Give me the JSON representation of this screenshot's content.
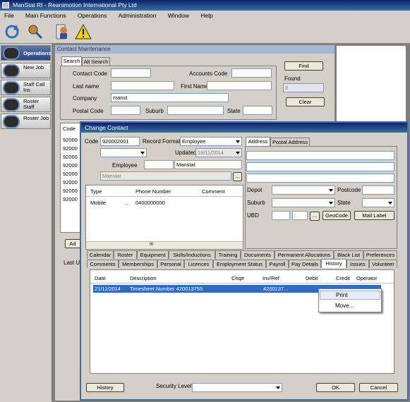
{
  "app": {
    "title": "ManStat RI - Reanimotion International Pty Ltd"
  },
  "menu": [
    "File",
    "Main Functions",
    "Operations",
    "Administration",
    "Window",
    "Help"
  ],
  "toolbar_icons": [
    "sync-icon",
    "search-people-icon",
    "user-card-icon",
    "warning-icon"
  ],
  "sidebar": {
    "items": [
      {
        "label": "Operations",
        "icon": "operations-icon"
      },
      {
        "label": "New Job",
        "icon": "new-job-icon"
      },
      {
        "label": "Staff Call Ins",
        "icon": "staff-call-icon"
      },
      {
        "label": "Roster Staff",
        "icon": "roster-staff-icon"
      },
      {
        "label": "Roster Job",
        "icon": "roster-job-icon"
      }
    ]
  },
  "contact_maintenance": {
    "title": "Contact Maintenance",
    "tabs": [
      "Search",
      "Alt Search"
    ],
    "fields": {
      "contact_code": "Contact Code",
      "accounts_code": "Accounts Code",
      "last_name": "Last name",
      "first_name": "First Name",
      "company": "Company",
      "company_value": "manst",
      "postal_code": "Postal Code",
      "suburb": "Suburb",
      "state": "State"
    },
    "find_button": "Find",
    "found_label": "Found",
    "found_value": "8",
    "clear_button": "Clear",
    "list_header": "Code",
    "list_codes": [
      "92000",
      "92000",
      "92000",
      "92000",
      "92000",
      "92000",
      "92000",
      "92000"
    ],
    "add_button_partial": "Ad",
    "last_upd_partial": "Last U"
  },
  "change_contact": {
    "title": "Change Contact",
    "code_label": "Code",
    "code_value": "920002001",
    "record_format_label": "Record Format",
    "record_format_value": "Employee",
    "updated_label": "Updated",
    "updated_value": "19/11/2014",
    "type_value": "Employee",
    "name_value": "Manstat",
    "company_value": "Manstat",
    "ellipsis": "...",
    "phone_headers": [
      "Type",
      "Phone Number",
      "Comment"
    ],
    "phone_rows": [
      {
        "type": "Mobile",
        "dots": "...",
        "number": "0400000000"
      }
    ],
    "scroll_mark": "III",
    "address_tabs": [
      "Address",
      "Postal Address"
    ],
    "depot_label": "Depot",
    "postcode_label": "Postcode",
    "suburb_label": "Suburb",
    "state_label": "State",
    "ubd_label": "UBD",
    "ubd_sep": ":",
    "geocode_button": "GeoCode",
    "maillabel_button": "Mail Label",
    "tabs_row1": [
      "Calendar",
      "Roster",
      "Equipment",
      "Skills/Inductions",
      "Training",
      "Documents",
      "Permanent Allocations",
      "Black List",
      "Preferences"
    ],
    "tabs_row2": [
      "Comments",
      "Memberships",
      "Personal",
      "Licences",
      "Employment Status",
      "Payroll",
      "Pay Details",
      "History",
      "Issues",
      "Volunteer"
    ],
    "history_headers": [
      "Date",
      "Description",
      "Chq#",
      "Inv/Ref",
      "Debit",
      "Credit",
      "Operator"
    ],
    "history_rows": [
      {
        "date": "21/11/2014",
        "description": "Timesheet Number 420013755",
        "inv": "4200137..."
      }
    ],
    "context_menu": [
      "Print",
      "Move..."
    ],
    "history_button": "History",
    "security_label": "Security Level",
    "ok_button": "OK",
    "cancel_button": "Cancel"
  }
}
